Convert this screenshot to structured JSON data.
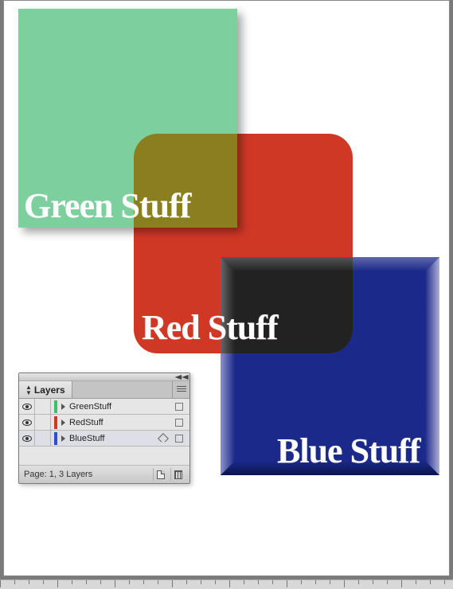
{
  "shapes": {
    "green": {
      "label": "Green Stuff",
      "color": "#7dcf9e"
    },
    "red": {
      "label": "Red Stuff",
      "color": "#d03826"
    },
    "blue": {
      "label": "Blue Stuff",
      "color": "#1b2a8a"
    }
  },
  "panel": {
    "title": "Layers",
    "layers": [
      {
        "name": "GreenStuff",
        "swatch": "#3fbf6a",
        "visible": true,
        "active": false
      },
      {
        "name": "RedStuff",
        "swatch": "#d03826",
        "visible": true,
        "active": false
      },
      {
        "name": "BlueStuff",
        "swatch": "#2a4fce",
        "visible": true,
        "active": true
      }
    ],
    "status": "Page: 1, 3 Layers"
  }
}
